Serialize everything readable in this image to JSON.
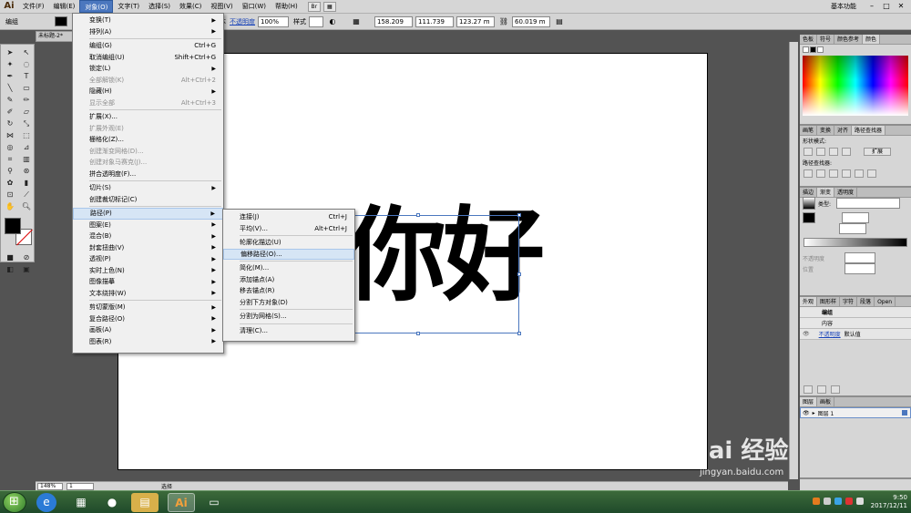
{
  "app": {
    "logo": "Ai",
    "menus": [
      "文件(F)",
      "编辑(E)",
      "对象(O)",
      "文字(T)",
      "选择(S)",
      "效果(C)",
      "视图(V)",
      "窗口(W)",
      "帮助(H)"
    ],
    "workspace_label": "基本功能",
    "win_controls": [
      "–",
      "□",
      "✕"
    ]
  },
  "controlbar": {
    "group_label": "编组",
    "stroke_style": "基本",
    "opacity_link": "不透明度",
    "opacity_value": "100%",
    "style_label": "样式",
    "x_value": "158.209",
    "y_value": "111.739",
    "w_value": "123.27 m",
    "h_value": "60.019 m"
  },
  "document": {
    "tab_label": "未标题-2*",
    "art_text": "你好"
  },
  "statusbar": {
    "zoom": "148%",
    "page": "1",
    "tool_label": "选择"
  },
  "object_menu": {
    "items": [
      {
        "label": "变换(T)",
        "shortcut": "",
        "sub": true,
        "disabled": false
      },
      {
        "label": "排列(A)",
        "shortcut": "",
        "sub": true,
        "disabled": false
      },
      {
        "sep": true
      },
      {
        "label": "编组(G)",
        "shortcut": "Ctrl+G",
        "sub": false,
        "disabled": false
      },
      {
        "label": "取消编组(U)",
        "shortcut": "Shift+Ctrl+G",
        "sub": false,
        "disabled": false
      },
      {
        "label": "锁定(L)",
        "shortcut": "",
        "sub": true,
        "disabled": false
      },
      {
        "label": "全部解锁(K)",
        "shortcut": "Alt+Ctrl+2",
        "sub": false,
        "disabled": true
      },
      {
        "label": "隐藏(H)",
        "shortcut": "",
        "sub": true,
        "disabled": false
      },
      {
        "label": "显示全部",
        "shortcut": "Alt+Ctrl+3",
        "sub": false,
        "disabled": true
      },
      {
        "sep": true
      },
      {
        "label": "扩展(X)...",
        "shortcut": "",
        "sub": false,
        "disabled": false
      },
      {
        "label": "扩展外观(E)",
        "shortcut": "",
        "sub": false,
        "disabled": true
      },
      {
        "label": "栅格化(Z)...",
        "shortcut": "",
        "sub": false,
        "disabled": false
      },
      {
        "label": "创建渐变网格(D)...",
        "shortcut": "",
        "sub": false,
        "disabled": true
      },
      {
        "label": "创建对象马赛克(J)...",
        "shortcut": "",
        "sub": false,
        "disabled": true
      },
      {
        "label": "拼合透明度(F)...",
        "shortcut": "",
        "sub": false,
        "disabled": false
      },
      {
        "sep": true
      },
      {
        "label": "切片(S)",
        "shortcut": "",
        "sub": true,
        "disabled": false
      },
      {
        "label": "创建裁切标记(C)",
        "shortcut": "",
        "sub": false,
        "disabled": false
      },
      {
        "sep": true
      },
      {
        "label": "路径(P)",
        "shortcut": "",
        "sub": true,
        "disabled": false,
        "highlight": true
      },
      {
        "label": "图案(E)",
        "shortcut": "",
        "sub": true,
        "disabled": false
      },
      {
        "label": "混合(B)",
        "shortcut": "",
        "sub": true,
        "disabled": false
      },
      {
        "label": "封套扭曲(V)",
        "shortcut": "",
        "sub": true,
        "disabled": false
      },
      {
        "label": "透视(P)",
        "shortcut": "",
        "sub": true,
        "disabled": false
      },
      {
        "label": "实时上色(N)",
        "shortcut": "",
        "sub": true,
        "disabled": false
      },
      {
        "label": "图像描摹",
        "shortcut": "",
        "sub": true,
        "disabled": false
      },
      {
        "label": "文本绕排(W)",
        "shortcut": "",
        "sub": true,
        "disabled": false
      },
      {
        "sep": true
      },
      {
        "label": "剪切蒙版(M)",
        "shortcut": "",
        "sub": true,
        "disabled": false
      },
      {
        "label": "复合路径(O)",
        "shortcut": "",
        "sub": true,
        "disabled": false
      },
      {
        "label": "画板(A)",
        "shortcut": "",
        "sub": true,
        "disabled": false
      },
      {
        "label": "图表(R)",
        "shortcut": "",
        "sub": true,
        "disabled": false
      }
    ]
  },
  "path_submenu": {
    "items": [
      {
        "label": "连接(J)",
        "shortcut": "Ctrl+J"
      },
      {
        "label": "平均(V)...",
        "shortcut": "Alt+Ctrl+J"
      },
      {
        "sep": true
      },
      {
        "label": "轮廓化描边(U)",
        "shortcut": ""
      },
      {
        "label": "偏移路径(O)...",
        "shortcut": "",
        "highlight": true
      },
      {
        "sep": true
      },
      {
        "label": "简化(M)...",
        "shortcut": ""
      },
      {
        "label": "添加锚点(A)",
        "shortcut": ""
      },
      {
        "label": "移去锚点(R)",
        "shortcut": ""
      },
      {
        "label": "分割下方对象(D)",
        "shortcut": ""
      },
      {
        "sep": true
      },
      {
        "label": "分割为网格(S)...",
        "shortcut": ""
      },
      {
        "sep": true
      },
      {
        "label": "清理(C)...",
        "shortcut": ""
      }
    ]
  },
  "panels": {
    "color_tabs": [
      "色板",
      "符号",
      "颜色参考",
      "颜色"
    ],
    "pathfinder_tabs": [
      "画笔",
      "变换",
      "对齐",
      "路径查找器"
    ],
    "shape_mode_label": "形状模式:",
    "expand_button": "扩展",
    "pathfinder_label": "路径查找器:",
    "gradient_tabs": [
      "描边",
      "渐变",
      "透明度"
    ],
    "gradient_type_label": "类型:",
    "opacity_label": "不透明度",
    "position_label": "位置",
    "appearance_tabs": [
      "外观",
      "图形样",
      "字符",
      "段落",
      "Open"
    ],
    "appearance_group": "编组",
    "appearance_content": "内容",
    "appearance_opacity": "不透明度",
    "appearance_default": "默认值",
    "layers_tabs": [
      "图层",
      "画板"
    ],
    "layer_name": "图层 1"
  },
  "taskbar": {
    "time": "9:50",
    "date": "2017/12/11",
    "active_app": "Ai"
  },
  "watermark": {
    "brand": "Bai 经验",
    "sub": "jingyan.baidu.com"
  },
  "colors": {
    "accent": "#4b77be",
    "menu_highlight": "#d6e5f5"
  }
}
